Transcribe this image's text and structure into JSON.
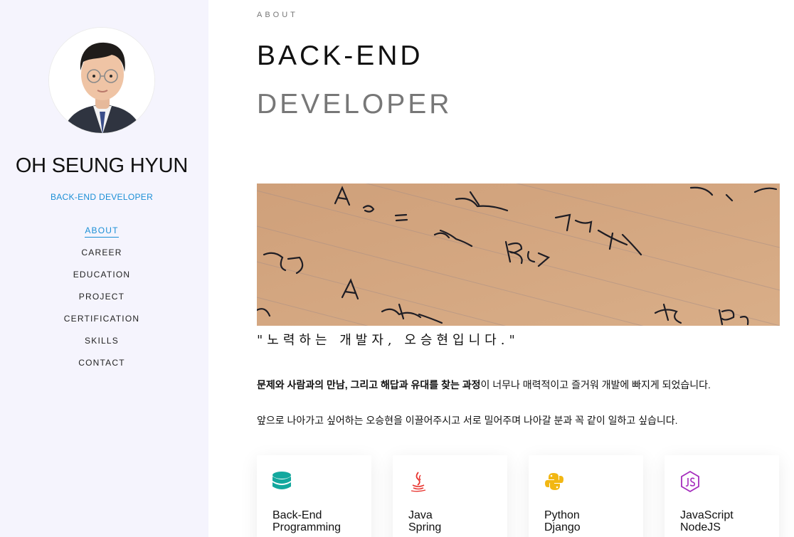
{
  "profile": {
    "name": "OH SEUNG HYUN",
    "role": "BACK-END DEVELOPER"
  },
  "nav": {
    "active": "ABOUT",
    "items": [
      "ABOUT",
      "CAREER",
      "EDUCATION",
      "PROJECT",
      "CERTIFICATION",
      "SKILLS",
      "CONTACT"
    ]
  },
  "about": {
    "eyebrow": "ABOUT",
    "heading_line1": "BACK-END",
    "heading_line2": "DEVELOPER",
    "quote": "\"노력하는 개발자, 오승현입니다.\"",
    "para1_bold": "문제와 사람과의 만남, 그리고 해답과 유대를 찾는 과정",
    "para1_rest": "이 너무나 매력적이고 즐거워 개발에 빠지게 되었습니다.",
    "para2": "앞으로 나아가고 싶어하는 오승현을 이끌어주시고 서로 밀어주며 나아갈 분과 꼭 같이 일하고 싶습니다."
  },
  "skills": [
    {
      "line1": "Back-End",
      "line2": "Programming",
      "icon": "database-icon",
      "color": "#13a89e"
    },
    {
      "line1": "Java",
      "line2": "Spring",
      "icon": "java-icon",
      "color": "#e8342f"
    },
    {
      "line1": "Python",
      "line2": "Django",
      "icon": "python-icon",
      "color": "#f2b713"
    },
    {
      "line1": "JavaScript",
      "line2": "NodeJS",
      "icon": "nodejs-icon",
      "color": "#a52dbd"
    }
  ],
  "colors": {
    "accent": "#1b8fd6",
    "sidebar_bg": "#f5f4fd"
  }
}
